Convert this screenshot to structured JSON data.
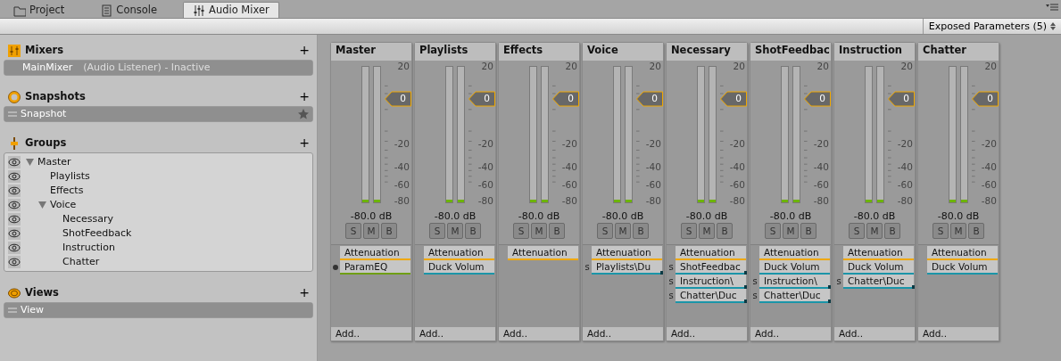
{
  "tabs": [
    {
      "label": "Project",
      "kind": "folder",
      "selected": false
    },
    {
      "label": "Console",
      "kind": "console",
      "selected": false
    },
    {
      "label": "Audio Mixer",
      "kind": "mixer",
      "selected": true
    }
  ],
  "toolbar": {
    "exposed_parameters": "Exposed Parameters (5)"
  },
  "mixers": {
    "title": "Mixers",
    "add": "+",
    "items": [
      {
        "name": "MainMixer",
        "detail": "(Audio Listener) - Inactive",
        "selected": true
      }
    ]
  },
  "snapshots": {
    "title": "Snapshots",
    "add": "+",
    "items": [
      {
        "name": "Snapshot",
        "selected": true,
        "start": true
      }
    ]
  },
  "groups": {
    "title": "Groups",
    "add": "+",
    "tree": [
      {
        "label": "Master",
        "expanded": true,
        "children": [
          {
            "label": "Playlists"
          },
          {
            "label": "Effects"
          },
          {
            "label": "Voice",
            "expanded": true,
            "children": [
              {
                "label": "Necessary"
              },
              {
                "label": "ShotFeedback"
              },
              {
                "label": "Instruction"
              },
              {
                "label": "Chatter"
              }
            ]
          }
        ]
      }
    ]
  },
  "views": {
    "title": "Views",
    "add": "+",
    "items": [
      {
        "name": "View",
        "selected": true
      }
    ]
  },
  "strips": [
    {
      "name": "Master",
      "scale": [
        "20",
        "-20",
        "-40",
        "-60",
        "-80"
      ],
      "fader": "0",
      "meters": [
        {
          "level": 0.02
        },
        {
          "level": 0.02
        }
      ],
      "reading": "-80.0 dB",
      "buttons": [
        "S",
        "M",
        "B"
      ],
      "effects": [
        {
          "kind": "attenuation",
          "label": "Attenuation",
          "color": "#f0a800"
        },
        {
          "kind": "effect",
          "label": "ParamEQ",
          "color": "#6f9f14"
        }
      ],
      "add": "Add.."
    },
    {
      "name": "Playlists",
      "scale": [
        "20",
        "-20",
        "-40",
        "-60",
        "-80"
      ],
      "fader": "0",
      "meters": [
        {
          "level": 0.02
        },
        {
          "level": 0.02
        }
      ],
      "reading": "-80.0 dB",
      "buttons": [
        "S",
        "M",
        "B"
      ],
      "effects": [
        {
          "kind": "attenuation",
          "label": "Attenuation",
          "color": "#f0a800"
        },
        {
          "kind": "receive",
          "label": "Duck Volum",
          "color": "#1b95a8"
        }
      ],
      "add": "Add.."
    },
    {
      "name": "Effects",
      "scale": [
        "20",
        "-20",
        "-40",
        "-60",
        "-80"
      ],
      "fader": "0",
      "meters": [
        {
          "level": 0.02
        },
        {
          "level": 0.02
        }
      ],
      "reading": "-80.0 dB",
      "buttons": [
        "S",
        "M",
        "B"
      ],
      "effects": [
        {
          "kind": "attenuation",
          "label": "Attenuation",
          "color": "#f0a800"
        }
      ],
      "add": "Add.."
    },
    {
      "name": "Voice",
      "scale": [
        "20",
        "-20",
        "-40",
        "-60",
        "-80"
      ],
      "fader": "0",
      "meters": [
        {
          "level": 0.02
        },
        {
          "level": 0.02
        }
      ],
      "reading": "-80.0 dB",
      "buttons": [
        "S",
        "M",
        "B"
      ],
      "effects": [
        {
          "kind": "attenuation",
          "label": "Attenuation",
          "color": "#f0a800"
        },
        {
          "kind": "send",
          "prefix": "s",
          "label": "Playlists\\Du",
          "color": "#1b95a8"
        }
      ],
      "add": "Add.."
    },
    {
      "name": "Necessary",
      "scale": [
        "20",
        "-20",
        "-40",
        "-60",
        "-80"
      ],
      "fader": "0",
      "meters": [
        {
          "level": 0.02
        },
        {
          "level": 0.02
        }
      ],
      "reading": "-80.0 dB",
      "buttons": [
        "S",
        "M",
        "B"
      ],
      "effects": [
        {
          "kind": "attenuation",
          "label": "Attenuation",
          "color": "#f0a800"
        },
        {
          "kind": "send",
          "prefix": "s",
          "label": "ShotFeedbac",
          "color": "#1b95a8"
        },
        {
          "kind": "send",
          "prefix": "s",
          "label": "Instruction\\",
          "color": "#1b95a8"
        },
        {
          "kind": "send",
          "prefix": "s",
          "label": "Chatter\\Duc",
          "color": "#1b95a8"
        }
      ],
      "add": "Add.."
    },
    {
      "name": "ShotFeedbac",
      "scale": [
        "20",
        "-20",
        "-40",
        "-60",
        "-80"
      ],
      "fader": "0",
      "meters": [
        {
          "level": 0.02
        },
        {
          "level": 0.02
        }
      ],
      "reading": "-80.0 dB",
      "buttons": [
        "S",
        "M",
        "B"
      ],
      "effects": [
        {
          "kind": "attenuation",
          "label": "Attenuation",
          "color": "#f0a800"
        },
        {
          "kind": "receive",
          "label": "Duck Volum",
          "color": "#1b95a8"
        },
        {
          "kind": "send",
          "prefix": "s",
          "label": "Instruction\\",
          "color": "#1b95a8"
        },
        {
          "kind": "send",
          "prefix": "s",
          "label": "Chatter\\Duc",
          "color": "#1b95a8"
        }
      ],
      "add": "Add.."
    },
    {
      "name": "Instruction",
      "scale": [
        "20",
        "-20",
        "-40",
        "-60",
        "-80"
      ],
      "fader": "0",
      "meters": [
        {
          "level": 0.02
        },
        {
          "level": 0.02
        }
      ],
      "reading": "-80.0 dB",
      "buttons": [
        "S",
        "M",
        "B"
      ],
      "effects": [
        {
          "kind": "attenuation",
          "label": "Attenuation",
          "color": "#f0a800"
        },
        {
          "kind": "receive",
          "label": "Duck Volum",
          "color": "#1b95a8"
        },
        {
          "kind": "send",
          "prefix": "s",
          "label": "Chatter\\Duc",
          "color": "#1b95a8"
        }
      ],
      "add": "Add.."
    },
    {
      "name": "Chatter",
      "scale": [
        "20",
        "-20",
        "-40",
        "-60",
        "-80"
      ],
      "fader": "0",
      "meters": [
        {
          "level": 0.02
        },
        {
          "level": 0.02
        }
      ],
      "reading": "-80.0 dB",
      "buttons": [
        "S",
        "M",
        "B"
      ],
      "effects": [
        {
          "kind": "attenuation",
          "label": "Attenuation",
          "color": "#f0a800"
        },
        {
          "kind": "receive",
          "label": "Duck Volum",
          "color": "#1b95a8"
        }
      ],
      "add": "Add.."
    }
  ]
}
